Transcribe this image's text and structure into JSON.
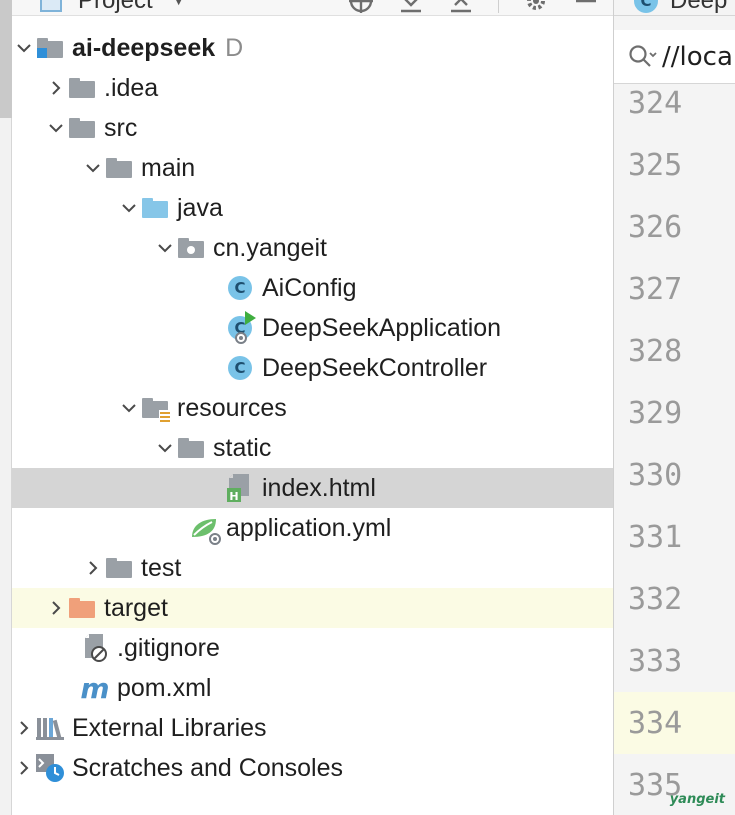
{
  "panel": {
    "title": "Project"
  },
  "editor": {
    "tab_label": "Deep",
    "search_text": "//loca",
    "line_numbers": [
      "324",
      "325",
      "326",
      "327",
      "328",
      "329",
      "330",
      "331",
      "332",
      "333",
      "334",
      "335"
    ],
    "current_line": "334",
    "watermark": "yangeit"
  },
  "tree": {
    "root": {
      "label": "ai-deepseek",
      "hint": "D",
      "expanded": true
    },
    "idea": {
      "label": ".idea",
      "expanded": false
    },
    "src": {
      "label": "src",
      "expanded": true
    },
    "main": {
      "label": "main",
      "expanded": true
    },
    "java": {
      "label": "java",
      "expanded": true
    },
    "package": {
      "label": "cn.yangeit",
      "expanded": true
    },
    "aiconfig": {
      "label": "AiConfig",
      "icon": "class-icon"
    },
    "app": {
      "label": "DeepSeekApplication",
      "icon": "spring-boot-class-icon"
    },
    "controller": {
      "label": "DeepSeekController",
      "icon": "class-icon"
    },
    "resources": {
      "label": "resources",
      "expanded": true
    },
    "static": {
      "label": "static",
      "expanded": true
    },
    "index": {
      "label": "index.html",
      "selected": true
    },
    "yml": {
      "label": "application.yml"
    },
    "test": {
      "label": "test",
      "expanded": false
    },
    "target": {
      "label": "target",
      "expanded": false,
      "highlighted": true
    },
    "gitignore": {
      "label": ".gitignore"
    },
    "pom": {
      "label": "pom.xml"
    },
    "libraries": {
      "label": "External Libraries",
      "expanded": false
    },
    "scratches": {
      "label": "Scratches and Consoles",
      "expanded": false
    }
  },
  "colors": {
    "selection": "#d5d5d5",
    "highlight": "#fbfbe4",
    "folder_gray": "#9aa0a6",
    "folder_blue": "#86c6e8",
    "folder_orange": "#f0a07a",
    "class_icon": "#79c3e8"
  }
}
